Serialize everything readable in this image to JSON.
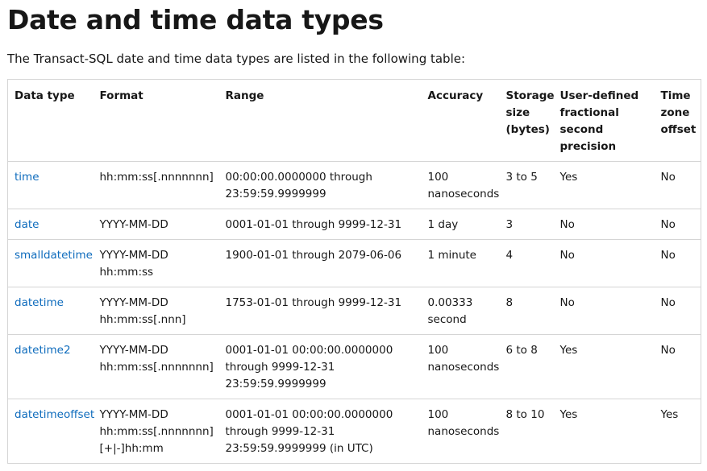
{
  "title": "Date and time data types",
  "intro": "The Transact-SQL date and time data types are listed in the following table:",
  "table": {
    "headers": [
      "Data type",
      "Format",
      "Range",
      "Accuracy",
      "Storage size (bytes)",
      "User-defined fractional second precision",
      "Time zone offset"
    ],
    "rows": [
      {
        "type": "time",
        "format": [
          "hh:mm:ss[.nnnnnnn]"
        ],
        "range": [
          "00:00:00.0000000 through",
          "23:59:59.9999999"
        ],
        "accuracy": [
          "100",
          "nanoseconds"
        ],
        "storage": "3 to 5",
        "precision": "Yes",
        "offset": "No"
      },
      {
        "type": "date",
        "format": [
          "YYYY-MM-DD"
        ],
        "range": [
          "0001-01-01 through 9999-12-31"
        ],
        "accuracy": [
          "1 day"
        ],
        "storage": "3",
        "precision": "No",
        "offset": "No"
      },
      {
        "type": "smalldatetime",
        "format": [
          "YYYY-MM-DD",
          "hh:mm:ss"
        ],
        "range": [
          "1900-01-01 through 2079-06-06"
        ],
        "accuracy": [
          "1 minute"
        ],
        "storage": "4",
        "precision": "No",
        "offset": "No"
      },
      {
        "type": "datetime",
        "format": [
          "YYYY-MM-DD",
          "hh:mm:ss[.nnn]"
        ],
        "range": [
          "1753-01-01 through 9999-12-31"
        ],
        "accuracy": [
          "0.00333",
          "second"
        ],
        "storage": "8",
        "precision": "No",
        "offset": "No"
      },
      {
        "type": "datetime2",
        "format": [
          "YYYY-MM-DD",
          "hh:mm:ss[.nnnnnnn]"
        ],
        "range": [
          "0001-01-01 00:00:00.0000000",
          "through 9999-12-31",
          "23:59:59.9999999"
        ],
        "accuracy": [
          "100",
          "nanoseconds"
        ],
        "storage": "6 to 8",
        "precision": "Yes",
        "offset": "No"
      },
      {
        "type": "datetimeoffset",
        "format": [
          "YYYY-MM-DD",
          "hh:mm:ss[.nnnnnnn]",
          "[+|-]hh:mm"
        ],
        "range": [
          "0001-01-01 00:00:00.0000000",
          "through 9999-12-31",
          "23:59:59.9999999 (in UTC)"
        ],
        "accuracy": [
          "100",
          "nanoseconds"
        ],
        "storage": "8 to 10",
        "precision": "Yes",
        "offset": "Yes"
      }
    ]
  }
}
